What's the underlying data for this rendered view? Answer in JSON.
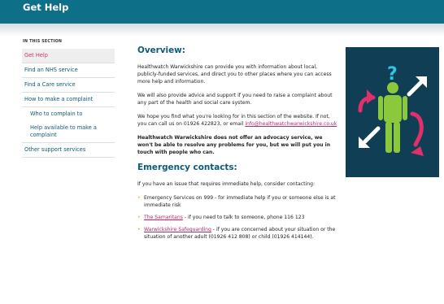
{
  "header": {
    "title": "Get Help"
  },
  "sidebar": {
    "section_label": "IN THIS SECTION",
    "items": [
      {
        "label": "Get Help"
      },
      {
        "label": "Find an NHS service"
      },
      {
        "label": "Find a Care service"
      },
      {
        "label": "How to make a complaint"
      },
      {
        "label": "Who to complain to"
      },
      {
        "label": "Help available to make a complaint"
      },
      {
        "label": "Other support services"
      }
    ]
  },
  "main": {
    "overview_heading": "Overview:",
    "p1": "Healthwatch Warwickshire can provide you with information about local, publicly-funded services, and direct you to other places where you can access more help and information.",
    "p2": "We will also provide advice and support if you need to raise a complaint about any part of the health and social care system.",
    "p3": "We hope you find what you're looking for in this section of the website.  If not, you can call us on 01926 422823, or email",
    "email": "info@healthwatchwarwickshire.co.uk",
    "p4": "Healthwatch Warwickshire does not offer an advocacy service, we won't be able to resolve any problems for you, but we will put you in touch with people who can.",
    "emergency_heading": "Emergency contacts:",
    "p5": "If you have an issue that requires immediate help, consider contacting:",
    "list": [
      {
        "text": "Emergency Services on 999 - for immediate help if you or someone else is at immediate risk"
      },
      {
        "link": "The Samaritans",
        "text": " - if you need to talk to someone, phone 116 123"
      },
      {
        "link": "Warwickshire Safeguarding",
        "text": " - if you are concerned about your situation or the situation of another adult (01926 412 808) or child (01926 414144)."
      }
    ]
  },
  "colors": {
    "header_bg": "#0d6f88",
    "link": "#c0266a",
    "heading": "#0d5a7a",
    "bullet": "#f2a516",
    "illustration_bg": "#0f3e55",
    "figure_green": "#8cc83c",
    "arrow_pink": "#e0306c",
    "question_cyan": "#33c4e0"
  },
  "illustration": {
    "icon": "person-with-arrows-question-icon"
  }
}
